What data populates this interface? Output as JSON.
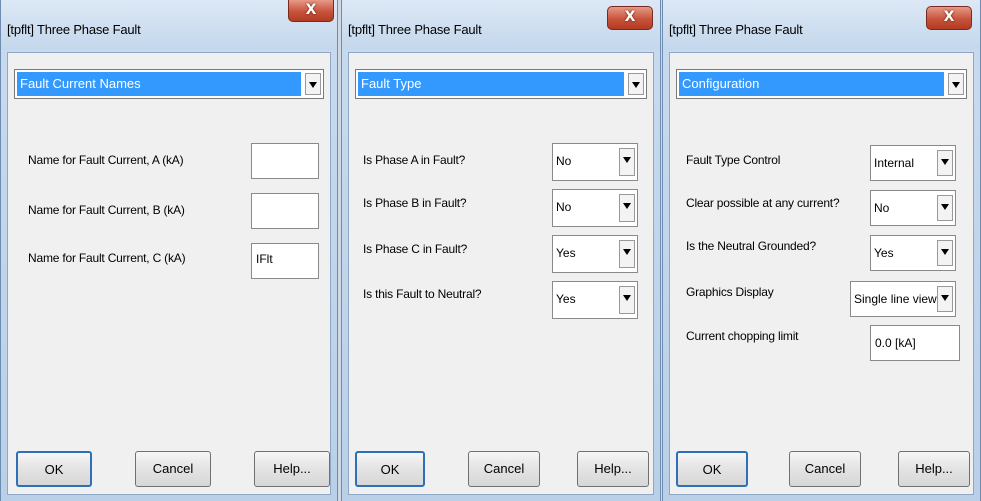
{
  "dialogs": [
    {
      "title": "[tpflt] Three Phase Fault",
      "close": "X",
      "section": "Fault Current Names",
      "fields": [
        {
          "label": "Name for Fault Current, A (kA)",
          "value": ""
        },
        {
          "label": "Name for Fault Current, B (kA)",
          "value": ""
        },
        {
          "label": "Name for Fault Current, C (kA)",
          "value": "IFlt"
        }
      ],
      "buttons": {
        "ok": "OK",
        "cancel": "Cancel",
        "help": "Help..."
      }
    },
    {
      "title": "[tpflt] Three Phase Fault",
      "close": "X",
      "section": "Fault Type",
      "fields": [
        {
          "label": "Is Phase A in Fault?",
          "value": "No"
        },
        {
          "label": "Is Phase B in Fault?",
          "value": "No"
        },
        {
          "label": "Is Phase C in Fault?",
          "value": "Yes"
        },
        {
          "label": "Is this Fault to Neutral?",
          "value": "Yes"
        }
      ],
      "buttons": {
        "ok": "OK",
        "cancel": "Cancel",
        "help": "Help..."
      }
    },
    {
      "title": "[tpflt] Three Phase Fault",
      "close": "X",
      "section": "Configuration",
      "fields": [
        {
          "label": "Fault Type Control",
          "value": "Internal"
        },
        {
          "label": "Clear possible at any current?",
          "value": "No"
        },
        {
          "label": "Is the Neutral Grounded?",
          "value": "Yes"
        },
        {
          "label": "Graphics Display",
          "value": "Single line view"
        },
        {
          "label": "Current chopping limit",
          "value": "0.0 [kA]"
        }
      ],
      "buttons": {
        "ok": "OK",
        "cancel": "Cancel",
        "help": "Help..."
      }
    }
  ],
  "colors": {
    "selection": "#3399ff",
    "close": "#c8533b"
  },
  "icons": {
    "dropdown": "chevron-down-icon",
    "close": "close-icon"
  }
}
